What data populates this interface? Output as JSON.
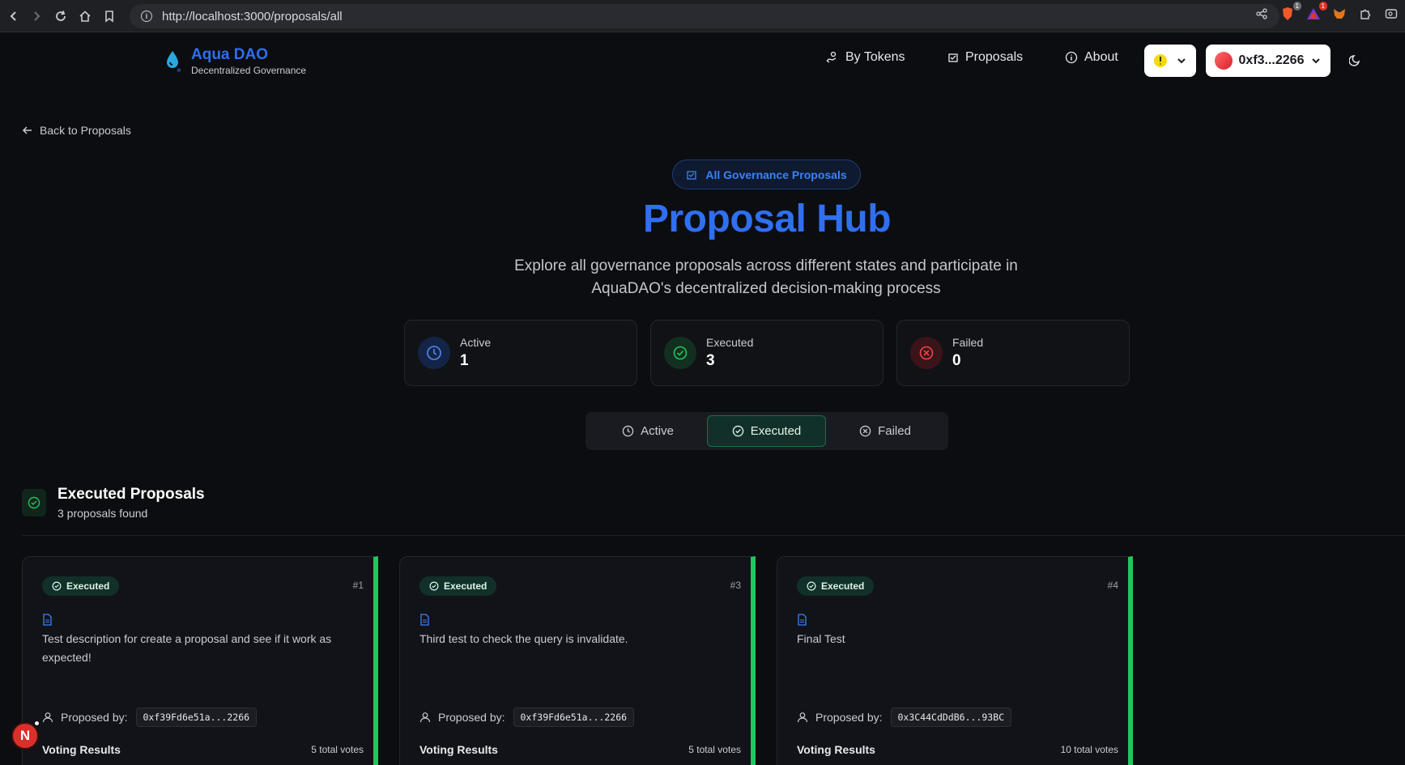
{
  "browser": {
    "url": "http://localhost:3000/proposals/all",
    "badges": {
      "brave": "1",
      "alerts": "1"
    }
  },
  "header": {
    "app_name": "Aqua DAO",
    "app_tagline": "Decentralized Governance",
    "nav": [
      {
        "label": "By Tokens",
        "icon": "hand-coins-icon"
      },
      {
        "label": "Proposals",
        "icon": "ballot-icon"
      },
      {
        "label": "About",
        "icon": "info-icon"
      }
    ],
    "wallet_address": "0xf3...2266",
    "colors": {
      "brand": "#2f6ff0",
      "accent_green": "#22c55e"
    }
  },
  "back_link": "Back to Proposals",
  "hero": {
    "pill": "All Governance Proposals",
    "title": "Proposal Hub",
    "description": "Explore all governance proposals across different states and participate in AquaDAO's decentralized decision-making process"
  },
  "stats": [
    {
      "label": "Active",
      "value": "1",
      "icon": "clock-icon"
    },
    {
      "label": "Executed",
      "value": "3",
      "icon": "check-circle-icon"
    },
    {
      "label": "Failed",
      "value": "0",
      "icon": "x-circle-icon"
    }
  ],
  "tabs": [
    {
      "label": "Active",
      "icon": "clock-icon",
      "active": false
    },
    {
      "label": "Executed",
      "icon": "check-circle-icon",
      "active": true
    },
    {
      "label": "Failed",
      "icon": "x-circle-icon",
      "active": false
    }
  ],
  "section": {
    "title": "Executed Proposals",
    "subtitle": "3 proposals found"
  },
  "cards": [
    {
      "status": "Executed",
      "number": "#1",
      "description": "Test description for create a proposal and see if it work as expected!",
      "proposed_by_label": "Proposed by:",
      "proposer": "0xf39Fd6e51a...2266",
      "voting_label": "Voting Results",
      "votes": "5 total votes"
    },
    {
      "status": "Executed",
      "number": "#3",
      "description": "Third test to check the query is invalidate.",
      "proposed_by_label": "Proposed by:",
      "proposer": "0xf39Fd6e51a...2266",
      "voting_label": "Voting Results",
      "votes": "5 total votes"
    },
    {
      "status": "Executed",
      "number": "#4",
      "description": "Final Test",
      "proposed_by_label": "Proposed by:",
      "proposer": "0x3C44CdDdB6...93BC",
      "voting_label": "Voting Results",
      "votes": "10 total votes"
    }
  ],
  "floating_avatar": "N"
}
